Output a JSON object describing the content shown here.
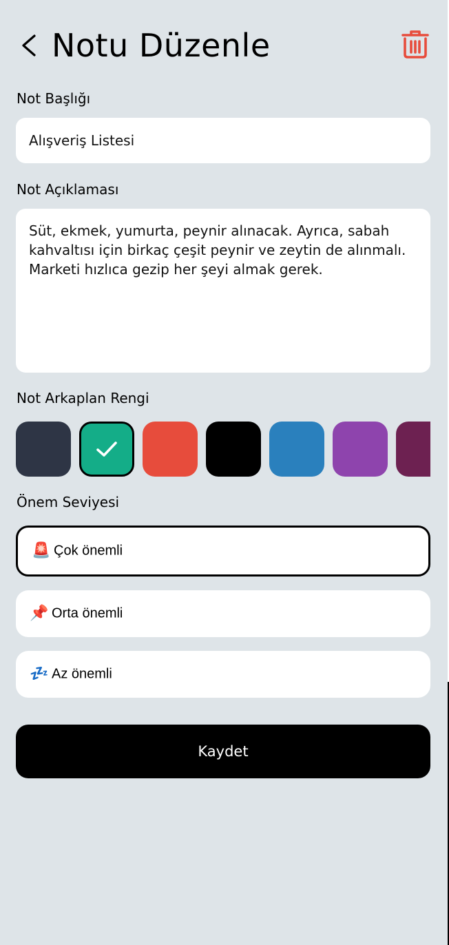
{
  "header": {
    "title": "Notu Düzenle",
    "back_icon": "chevron-left-icon",
    "delete_icon": "trash-icon",
    "delete_color": "#e74c3c"
  },
  "form": {
    "title_label": "Not Başlığı",
    "title_value": "Alışveriş Listesi",
    "description_label": "Not Açıklaması",
    "description_value": "Süt, ekmek, yumurta, peynir alınacak. Ayrıca, sabah kahvaltısı için birkaç çeşit peynir ve zeytin de alınmalı. Marketi hızlıca gezip her şeyi almak gerek.",
    "color_label": "Not Arkaplan Rengi",
    "colors": [
      {
        "hex": "#2e3545",
        "selected": false
      },
      {
        "hex": "#14ad88",
        "selected": true
      },
      {
        "hex": "#e74c3c",
        "selected": false
      },
      {
        "hex": "#000000",
        "selected": false
      },
      {
        "hex": "#2a80bd",
        "selected": false
      },
      {
        "hex": "#8e44ad",
        "selected": false
      },
      {
        "hex": "#6d2151",
        "selected": false
      }
    ],
    "priority_label": "Önem Seviyesi",
    "priorities": [
      {
        "emoji": "🚨",
        "label": "Çok önemli",
        "selected": true
      },
      {
        "emoji": "📌",
        "label": "Orta önemli",
        "selected": false
      },
      {
        "emoji": "💤",
        "label": "Az önemli",
        "selected": false
      }
    ]
  },
  "save_label": "Kaydet"
}
